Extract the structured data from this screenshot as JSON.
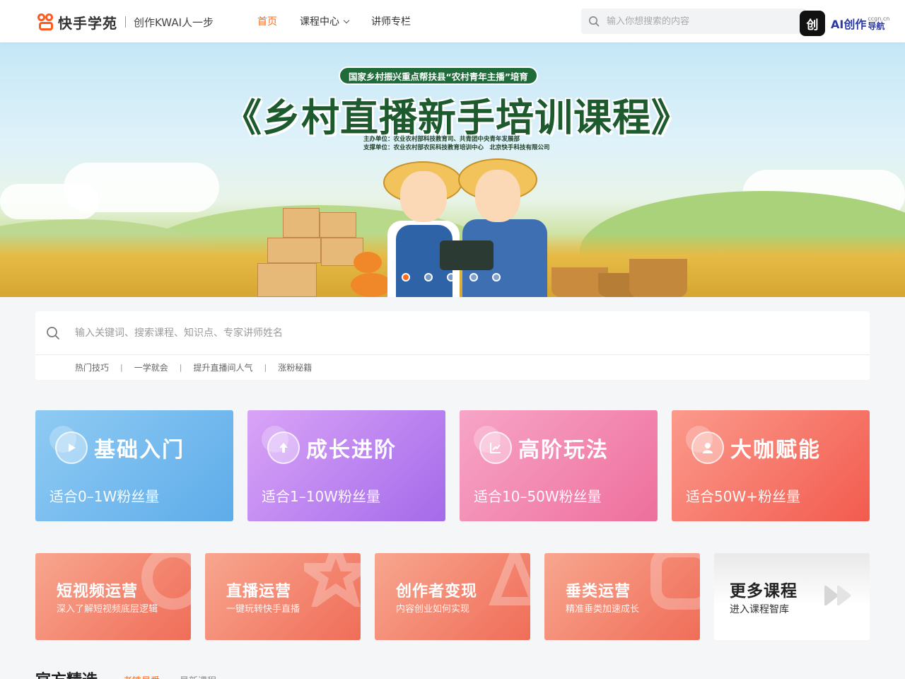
{
  "header": {
    "brand": "快手学苑",
    "slogan": "创作KWAI人一步",
    "nav": [
      {
        "label": "首页"
      },
      {
        "label": "课程中心"
      },
      {
        "label": "讲师专栏"
      }
    ],
    "search_placeholder": "输入你想搜索的内容",
    "ai_badge": {
      "icon_text": "创",
      "label": "AI创作",
      "sub_domain": "ccgn.cn",
      "sub_label": "导航"
    }
  },
  "banner": {
    "tag": "国家乡村振兴重点帮扶县“农村青年主播”培育",
    "title": "《乡村直播新手培训课程》",
    "organizer": "主办单位：农业农村部科技教育司、共青团中央青年发展部",
    "supporter": "支撑单位：农业农村部农民科技教育培训中心　北京快手科技有限公司",
    "slides": 5,
    "active_slide": 1
  },
  "search_panel": {
    "placeholder": "输入关键词、搜索课程、知识点、专家讲师姓名",
    "tags": [
      "热门技巧",
      "一学就会",
      "提升直播间人气",
      "涨粉秘籍"
    ]
  },
  "level_cards": [
    {
      "title": "基础入门",
      "subtitle": "适合0–1W粉丝量",
      "icon": "play-icon"
    },
    {
      "title": "成长进阶",
      "subtitle": "适合1–10W粉丝量",
      "icon": "arrow-up-icon"
    },
    {
      "title": "高阶玩法",
      "subtitle": "适合10–50W粉丝量",
      "icon": "chart-icon"
    },
    {
      "title": "大咖赋能",
      "subtitle": "适合50W+粉丝量",
      "icon": "user-icon"
    }
  ],
  "topic_cards": [
    {
      "title": "短视频运营",
      "subtitle": "深入了解短视频底层逻辑"
    },
    {
      "title": "直播运营",
      "subtitle": "一键玩转快手直播"
    },
    {
      "title": "创作者变现",
      "subtitle": "内容创业如何实现"
    },
    {
      "title": "垂类运营",
      "subtitle": "精准垂类加速成长"
    }
  ],
  "more_card": {
    "title": "更多课程",
    "subtitle": "进入课程智库"
  },
  "section": {
    "title": "官方精选",
    "tabs": [
      {
        "label": "老铁最爱"
      },
      {
        "label": "最新课程"
      }
    ]
  },
  "colors": {
    "accent": "#ff6a1a",
    "banner_green": "#1d5a2e"
  }
}
